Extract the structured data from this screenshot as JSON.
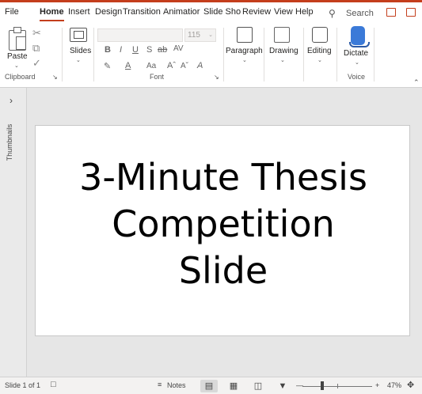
{
  "ribbon_tabs": [
    "File",
    "Home",
    "Insert",
    "Design",
    "Transition",
    "Animatior",
    "Slide Shov",
    "Review",
    "View",
    "Help"
  ],
  "search": {
    "label": "Search"
  },
  "ribbon": {
    "clipboard": {
      "paste_label": "Paste",
      "group_label": "Clipboard"
    },
    "slides": {
      "label": "Slides"
    },
    "font": {
      "size": "115",
      "bold": "B",
      "italic": "I",
      "underline": "U",
      "shadow": "S",
      "strike": "ab",
      "spacing": "AV",
      "font_color": "A",
      "change_case": "Aa",
      "grow": "Aˆ",
      "shrink": "Aˇ",
      "clear": "A",
      "group_label": "Font"
    },
    "paragraph": {
      "label": "Paragraph"
    },
    "drawing": {
      "label": "Drawing"
    },
    "editing": {
      "label": "Editing"
    },
    "voice": {
      "dictate_label": "Dictate",
      "group_label": "Voice"
    }
  },
  "thumbnails": {
    "label": "Thumbnails"
  },
  "slide": {
    "title_lines": [
      "3-Minute Thesis",
      "Competition",
      "Slide"
    ]
  },
  "statusbar": {
    "slide_indicator": "Slide 1 of 1",
    "notes_label": "Notes",
    "zoom_minus": "—",
    "zoom_plus": "+",
    "zoom_percent": "47%"
  },
  "accent_color": "#c43e1c",
  "icons": [
    "cut-icon",
    "copy-icon",
    "format-painter-icon",
    "paste-icon",
    "slides-icon",
    "paragraph-icon",
    "drawing-icon",
    "editing-icon",
    "dictate-icon",
    "search-icon",
    "share-icon",
    "comment-icon",
    "notes-icon",
    "normal-view-icon",
    "slide-sorter-icon",
    "reading-view-icon",
    "slideshow-icon",
    "fit-to-window-icon"
  ]
}
